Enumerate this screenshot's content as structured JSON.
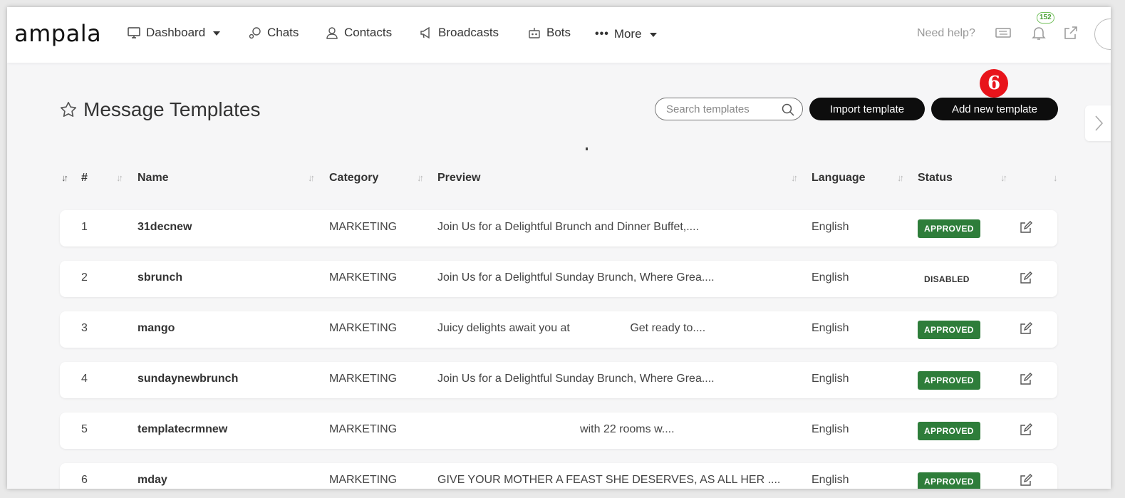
{
  "brand": {
    "logo_text": "ampala"
  },
  "nav": {
    "items": [
      {
        "label": "Dashboard",
        "icon": "monitor-icon",
        "dropdown": true
      },
      {
        "label": "Chats",
        "icon": "chat-bubble-icon",
        "dropdown": false
      },
      {
        "label": "Contacts",
        "icon": "person-icon",
        "dropdown": false
      },
      {
        "label": "Broadcasts",
        "icon": "megaphone-icon",
        "dropdown": false
      },
      {
        "label": "Bots",
        "icon": "robot-icon",
        "dropdown": false
      },
      {
        "label": "More",
        "icon": "dots-icon",
        "dropdown": true
      }
    ],
    "help_text": "Need help?",
    "notification_count": "152"
  },
  "page": {
    "title": "Message Templates",
    "search_placeholder": "Search templates",
    "import_label": "Import template",
    "add_label": "Add new template",
    "step_marker": "6"
  },
  "table": {
    "headers": {
      "index": "#",
      "name": "Name",
      "category": "Category",
      "preview": "Preview",
      "language": "Language",
      "status": "Status"
    },
    "rows": [
      {
        "num": "1",
        "name": "31decnew",
        "category": "MARKETING",
        "preview": "Join Us for a Delightful Brunch and Dinner Buffet,....",
        "language": "English",
        "status": "APPROVED"
      },
      {
        "num": "2",
        "name": "sbrunch",
        "category": "MARKETING",
        "preview": "Join Us for a Delightful Sunday Brunch, Where Grea....",
        "language": "English",
        "status": "DISABLED"
      },
      {
        "num": "3",
        "name": "mango",
        "category": "MARKETING",
        "preview": "Juicy delights await you at                   Get ready to....",
        "language": "English",
        "status": "APPROVED"
      },
      {
        "num": "4",
        "name": "sundaynewbrunch",
        "category": "MARKETING",
        "preview": "Join Us for a Delightful Sunday Brunch, Where Grea....",
        "language": "English",
        "status": "APPROVED"
      },
      {
        "num": "5",
        "name": "templatecrmnew",
        "category": "MARKETING",
        "preview": "                                             with 22 rooms w....",
        "language": "English",
        "status": "APPROVED"
      },
      {
        "num": "6",
        "name": "mday",
        "category": "MARKETING",
        "preview": "GIVE YOUR MOTHER A FEAST SHE DESERVES, AS ALL HER ....",
        "language": "English",
        "status": "APPROVED"
      }
    ]
  },
  "colors": {
    "approved": "#2e7d3a",
    "button": "#0d0d0d",
    "marker": "#e8141b",
    "badge_border": "#72c05b"
  }
}
